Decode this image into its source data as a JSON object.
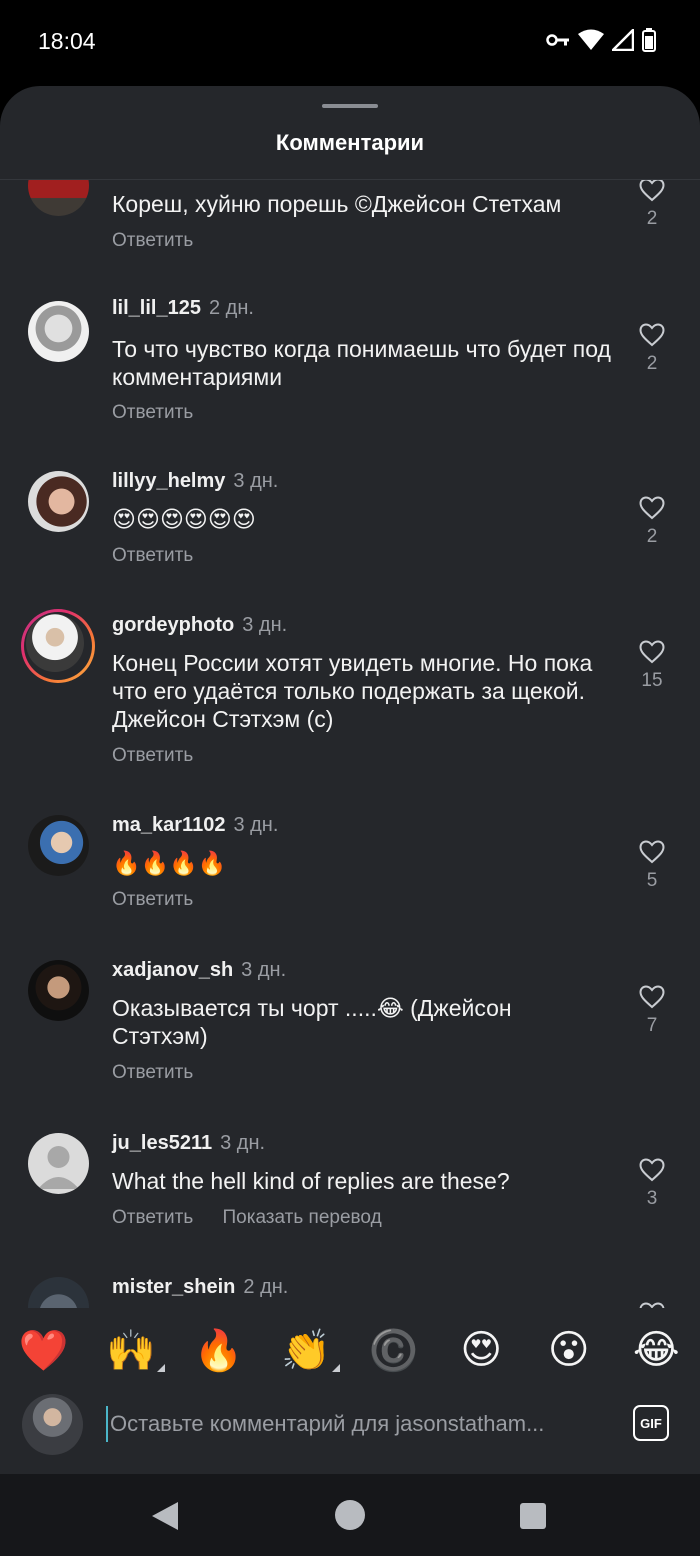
{
  "status_bar": {
    "time": "18:04"
  },
  "sheet": {
    "title": "Комментарии"
  },
  "comments": [
    {
      "username": "",
      "time": "",
      "text": "Кореш, хуйню порешь ©Джейсон Стетхам",
      "reply": "Ответить",
      "likes": "2"
    },
    {
      "username": "lil_lil_125",
      "time": "2 дн.",
      "text": "То что чувство когда понимаешь что будет под комментариями",
      "reply": "Ответить",
      "likes": "2"
    },
    {
      "username": "lillyy_helmy",
      "time": "3 дн.",
      "text": "😍😍😍😍😍😍",
      "reply": "Ответить",
      "likes": "2"
    },
    {
      "username": "gordeyphoto",
      "time": "3 дн.",
      "text": "Конец России хотят увидеть многие. Но пока что его удаётся только подержать за щекой. Джейсон Стэтхэм (с)",
      "reply": "Ответить",
      "likes": "15"
    },
    {
      "username": "ma_kar1102",
      "time": "3 дн.",
      "text": "🔥🔥🔥🔥",
      "reply": "Ответить",
      "likes": "5"
    },
    {
      "username": "xadjanov_sh",
      "time": "3 дн.",
      "text": "Оказывается ты чорт .....😂 (Джейсон Стэтхэм)",
      "reply": "Ответить",
      "likes": "7"
    },
    {
      "username": "ju_les5211",
      "time": "3 дн.",
      "text": "What the hell kind of replies are these?",
      "reply": "Ответить",
      "translate": "Показать перевод",
      "likes": "3"
    },
    {
      "username": "mister_shein",
      "time": "2 дн."
    }
  ],
  "emoji_bar": [
    "❤️",
    "🙌",
    "🔥",
    "👏",
    "©️",
    "😍",
    "😮",
    "😂"
  ],
  "composer": {
    "placeholder": "Оставьте комментарий для jasonstatham...",
    "gif_label": "GIF"
  },
  "colors": {
    "sheet_bg": "#25272b",
    "muted_text": "#9a9da3",
    "cursor": "#4bb6c9"
  }
}
